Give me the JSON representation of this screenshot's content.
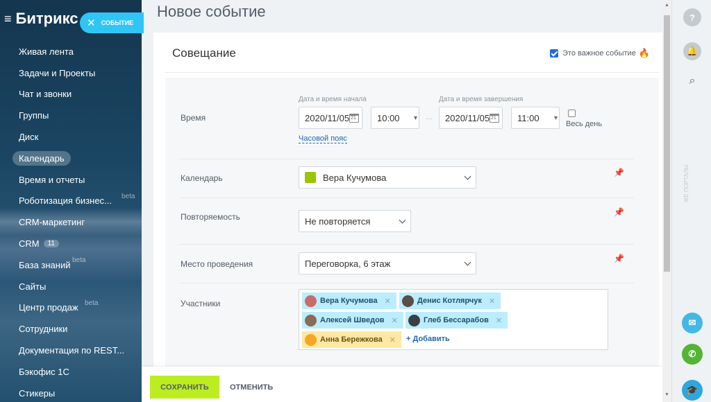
{
  "sidebar": {
    "brand": "Битрикс",
    "close_label": "СОБЫТИЕ",
    "items": [
      {
        "label": "Живая лента"
      },
      {
        "label": "Задачи и Проекты"
      },
      {
        "label": "Чат и звонки"
      },
      {
        "label": "Группы"
      },
      {
        "label": "Диск"
      },
      {
        "label": "Календарь"
      },
      {
        "label": "Время и отчеты"
      },
      {
        "label": "Роботизация бизнес...",
        "badge": "beta"
      },
      {
        "label": "CRM-маркетинг"
      },
      {
        "label": "CRM",
        "count": "11"
      },
      {
        "label": "База знаний",
        "badge": "beta"
      },
      {
        "label": "Сайты"
      },
      {
        "label": "Центр продаж",
        "badge": "beta"
      },
      {
        "label": "Сотрудники"
      },
      {
        "label": "Документация по REST..."
      },
      {
        "label": "Бэкофис 1С"
      },
      {
        "label": "Стикеры"
      }
    ]
  },
  "page": {
    "title": "Новое событие",
    "event_name": "Совещание",
    "important_label": "Это важное событие"
  },
  "form": {
    "time": {
      "label": "Время",
      "start_label": "Дата и время начала",
      "start_date": "2020/11/05",
      "start_time": "10:00",
      "end_label": "Дата и время завершения",
      "end_date": "2020/11/05",
      "end_time": "11:00",
      "all_day": "Весь день",
      "timezone_link": "Часовой пояс"
    },
    "calendar": {
      "label": "Календарь",
      "value": "Вера Кучумова",
      "color": "#9ac500"
    },
    "repeat": {
      "label": "Повторяемость",
      "value": "Не повторяется"
    },
    "location": {
      "label": "Место проведения",
      "value": "Переговорка, 6 этаж"
    },
    "attendees": {
      "label": "Участники",
      "people": [
        {
          "name": "Вера Кучумова"
        },
        {
          "name": "Денис Котлярчук"
        },
        {
          "name": "Алексей Шведов"
        },
        {
          "name": "Глеб Бессарабов"
        },
        {
          "name": "Анна Бережкова"
        }
      ],
      "add_label": "+ Добавить"
    }
  },
  "footer": {
    "save": "СОХРАНИТЬ",
    "cancel": "ОТМЕНИТЬ"
  },
  "right_bar": {
    "help": "?",
    "vertical_text": "ЖЕ ПОРТАЛЫ"
  },
  "colors": {
    "accent": "#2fc6f6",
    "save": "#bbed21",
    "chip": "#bcedfc",
    "chip_me": "#ffe8a3"
  }
}
